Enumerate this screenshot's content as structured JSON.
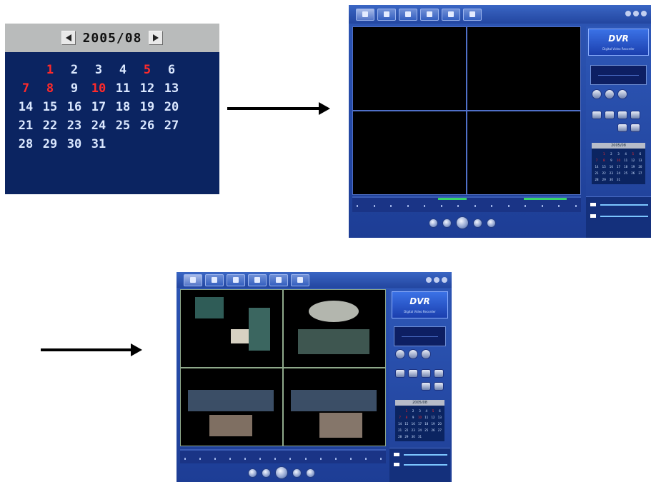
{
  "calendar": {
    "title": "2005/08",
    "prev_icon": "triangle-left-icon",
    "next_icon": "triangle-right-icon",
    "days": [
      {
        "d": "",
        "holiday": false
      },
      {
        "d": "1",
        "holiday": true
      },
      {
        "d": "2",
        "holiday": false
      },
      {
        "d": "3",
        "holiday": false
      },
      {
        "d": "4",
        "holiday": false
      },
      {
        "d": "5",
        "holiday": true
      },
      {
        "d": "6",
        "holiday": false
      },
      {
        "d": "7",
        "holiday": true
      },
      {
        "d": "8",
        "holiday": true
      },
      {
        "d": "9",
        "holiday": false
      },
      {
        "d": "10",
        "holiday": true
      },
      {
        "d": "11",
        "holiday": false
      },
      {
        "d": "12",
        "holiday": false
      },
      {
        "d": "13",
        "holiday": false
      },
      {
        "d": "14",
        "holiday": false
      },
      {
        "d": "15",
        "holiday": false
      },
      {
        "d": "16",
        "holiday": false
      },
      {
        "d": "17",
        "holiday": false
      },
      {
        "d": "18",
        "holiday": false
      },
      {
        "d": "19",
        "holiday": false
      },
      {
        "d": "20",
        "holiday": false
      },
      {
        "d": "21",
        "holiday": false
      },
      {
        "d": "22",
        "holiday": false
      },
      {
        "d": "23",
        "holiday": false
      },
      {
        "d": "24",
        "holiday": false
      },
      {
        "d": "25",
        "holiday": false
      },
      {
        "d": "26",
        "holiday": false
      },
      {
        "d": "27",
        "holiday": false
      },
      {
        "d": "28",
        "holiday": false
      },
      {
        "d": "29",
        "holiday": false
      },
      {
        "d": "30",
        "holiday": false
      },
      {
        "d": "31",
        "holiday": false
      }
    ]
  },
  "dvr_top": {
    "logo": "DVR",
    "logo_sub": "Digital Video Recorder",
    "mini_calendar_title": "2005/08",
    "video_state": "no-signal"
  },
  "dvr_bottom": {
    "logo": "DVR",
    "logo_sub": "Digital Video Recorder",
    "mini_calendar_title": "2005/08",
    "video_state": "playing"
  },
  "colors": {
    "calendar_bg": "#0b2461",
    "calendar_header": "#b9bbbb",
    "holiday": "#ff2a2a",
    "day_text": "#dbe8ff",
    "dvr_frame": "#2346a0"
  }
}
